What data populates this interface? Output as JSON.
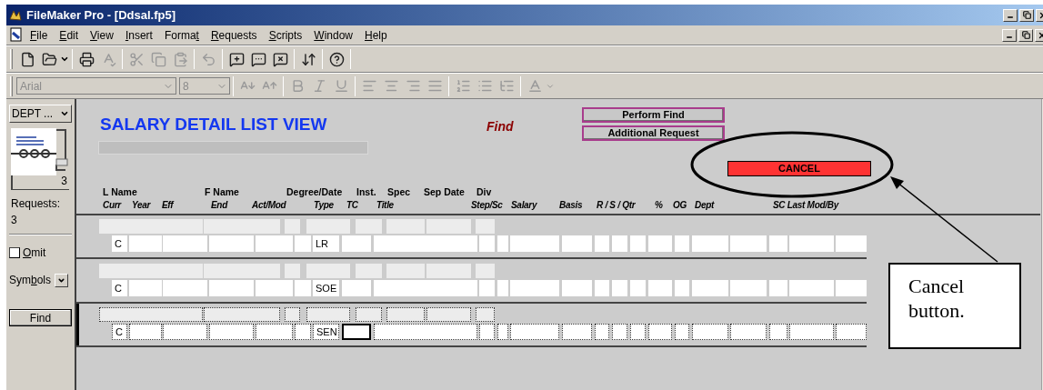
{
  "window": {
    "title": "FileMaker Pro - [Ddsal.fp5]"
  },
  "menu": [
    {
      "key": "F",
      "after": "ile"
    },
    {
      "key": "E",
      "after": "dit"
    },
    {
      "key": "V",
      "after": "iew"
    },
    {
      "key": "I",
      "after": "nsert"
    },
    {
      "before": "Forma",
      "key": "t"
    },
    {
      "key": "R",
      "after": "equests"
    },
    {
      "key": "S",
      "after": "cripts"
    },
    {
      "key": "W",
      "after": "indow"
    },
    {
      "key": "H",
      "after": "elp"
    }
  ],
  "format_bar": {
    "font": "Arial",
    "size": "8"
  },
  "status_panel": {
    "layout_menu": "DEPT ...",
    "book_count": "3",
    "requests_label": "Requests:",
    "requests_count": "3",
    "omit": {
      "key": "O",
      "after": "mit",
      "checked": false
    },
    "symbols": {
      "before": "Sym",
      "key": "b",
      "after": "ols"
    },
    "find_button": "Find"
  },
  "layout": {
    "title": "SALARY DETAIL LIST VIEW",
    "mode": "Find",
    "buttons": [
      "Perform Find",
      "Additional Request"
    ],
    "cancel_button": "CANCEL",
    "header_row_1": [
      "L Name",
      "F Name",
      "Degree/Date",
      "Inst.",
      "Spec",
      "Sep Date",
      "Div"
    ],
    "header_row_2": [
      "Curr",
      "Year",
      "Eff",
      "End",
      "Act/Mod",
      "Type",
      "TC",
      "Title",
      "Step/Sc",
      "Salary",
      "Basis",
      "R / S / Qtr",
      "%",
      "OG",
      "Dept",
      "SC Last Mod/By"
    ],
    "records": [
      {
        "curr": "C",
        "type": "LR",
        "selected": false,
        "tc_focused": false
      },
      {
        "curr": "C",
        "type": "SOE",
        "selected": false,
        "tc_focused": false
      },
      {
        "curr": "C",
        "type": "SEN",
        "selected": true,
        "tc_focused": true
      }
    ]
  },
  "callout": {
    "text": "Cancel button."
  }
}
